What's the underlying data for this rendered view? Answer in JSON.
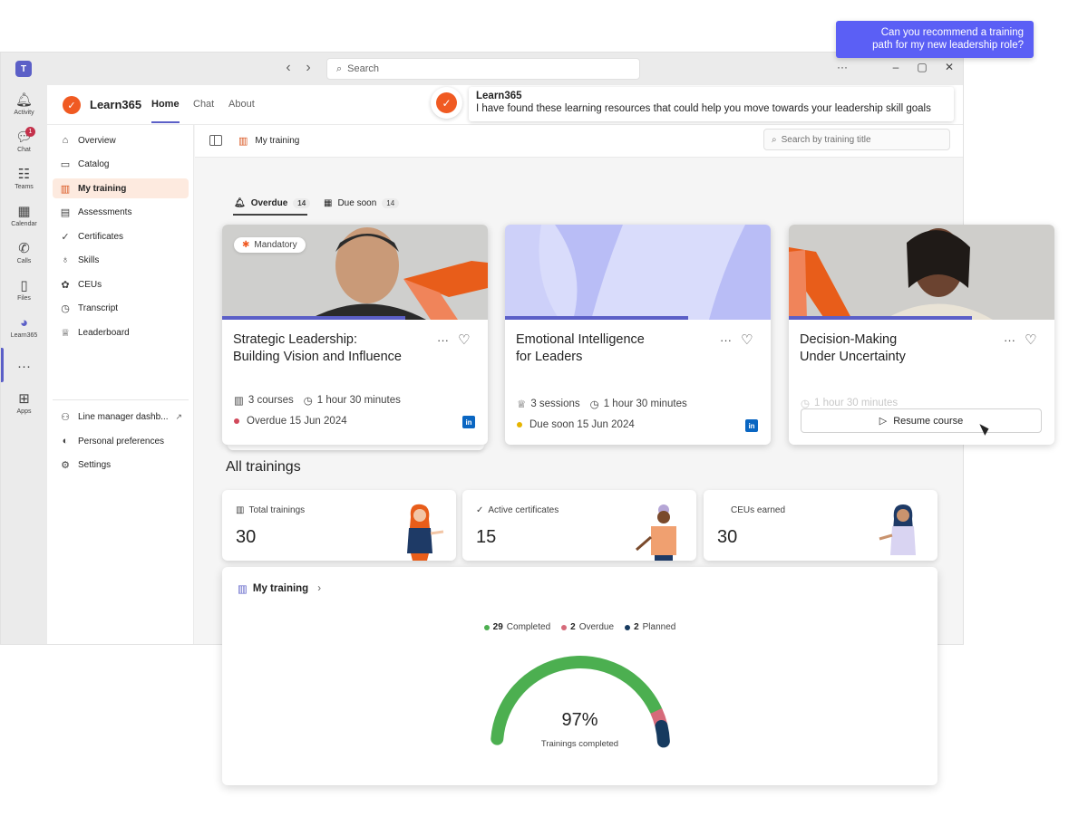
{
  "window": {
    "search_placeholder": "Search",
    "controls": [
      "···",
      "–",
      "▢",
      "✕"
    ]
  },
  "rail": {
    "items": [
      {
        "label": "Activity",
        "icon": "bell-icon"
      },
      {
        "label": "Chat",
        "icon": "chat-icon",
        "badge": "1"
      },
      {
        "label": "Teams",
        "icon": "teams-icon"
      },
      {
        "label": "Calendar",
        "icon": "calendar-icon"
      },
      {
        "label": "Calls",
        "icon": "phone-icon"
      },
      {
        "label": "Files",
        "icon": "file-icon"
      },
      {
        "label": "Learn365",
        "icon": "learn365-icon"
      },
      {
        "label": "···",
        "icon": "more-icon"
      },
      {
        "label": "Apps",
        "icon": "apps-icon"
      }
    ]
  },
  "app": {
    "name": "Learn365",
    "tabs": [
      "Home",
      "Chat",
      "About"
    ]
  },
  "sidebar": {
    "items": [
      {
        "label": "Overview",
        "icon": "home-icon"
      },
      {
        "label": "Catalog",
        "icon": "folder-icon"
      },
      {
        "label": "My training",
        "icon": "book-icon"
      },
      {
        "label": "Assessments",
        "icon": "document-icon"
      },
      {
        "label": "Certificates",
        "icon": "certificate-icon"
      },
      {
        "label": "Skills",
        "icon": "skills-icon"
      },
      {
        "label": "CEUs",
        "icon": "ceu-icon"
      },
      {
        "label": "Transcript",
        "icon": "history-icon"
      },
      {
        "label": "Leaderboard",
        "icon": "trophy-icon"
      },
      {
        "label": "Line manager dashb...",
        "icon": "manager-icon"
      },
      {
        "label": "Personal preferences",
        "icon": "toggle-icon"
      },
      {
        "label": "Settings",
        "icon": "gear-icon"
      }
    ]
  },
  "toolbar": {
    "breadcrumb": "My training",
    "search_placeholder": "Search by training title"
  },
  "filters": [
    {
      "label": "Overdue",
      "count": "14"
    },
    {
      "label": "Due soon",
      "count": "14"
    }
  ],
  "courses": [
    {
      "tag": "Mandatory",
      "title_line1": "Strategic Leadership:",
      "title_line2": "Building Vision and Influence",
      "meta1": "3 courses",
      "duration": "1 hour 30 minutes",
      "status": "Overdue 15 Jun 2024",
      "status_color": "#d1495b",
      "progress": 0.69
    },
    {
      "title_line1": "Emotional Intelligence",
      "title_line2": "for Leaders",
      "meta1": "3 sessions",
      "duration": "1 hour 30 minutes",
      "status": "Due soon 15 Jun 2024",
      "status_color": "#e6b400",
      "progress": 0.69
    },
    {
      "title_line1": "Decision-Making",
      "title_line2": "Under Uncertainty",
      "duration": "1 hour 30 minutes",
      "action": "Resume course",
      "progress": 0.69
    }
  ],
  "all_trainings": {
    "title": "All trainings",
    "stats": [
      {
        "label": "Total trainings",
        "value": "30",
        "icon": "book-icon"
      },
      {
        "label": "Active certificates",
        "value": "15",
        "icon": "certificate-icon"
      },
      {
        "label": "CEUs earned",
        "value": "30"
      }
    ]
  },
  "summary": {
    "title": "My training",
    "legend": [
      {
        "count": "29",
        "label": "Completed",
        "color": "#4caf50"
      },
      {
        "count": "2",
        "label": "Overdue",
        "color": "#d66a7a"
      },
      {
        "count": "2",
        "label": "Planned",
        "color": "#163a5f"
      }
    ],
    "percent": "97%",
    "caption": "Trainings completed"
  },
  "chart_data": {
    "type": "pie",
    "categories": [
      "Completed",
      "Overdue",
      "Planned"
    ],
    "values": [
      29,
      2,
      2
    ],
    "title": "",
    "colors": [
      "#4caf50",
      "#d66a7a",
      "#163a5f"
    ]
  },
  "copilot": {
    "prompt_line1": "Can you recommend a training",
    "prompt_line2": "path for my new leadership role?",
    "bot_name": "Learn365",
    "bot_message": "I have found these learning resources that could help you move towards your leadership skill goals"
  }
}
